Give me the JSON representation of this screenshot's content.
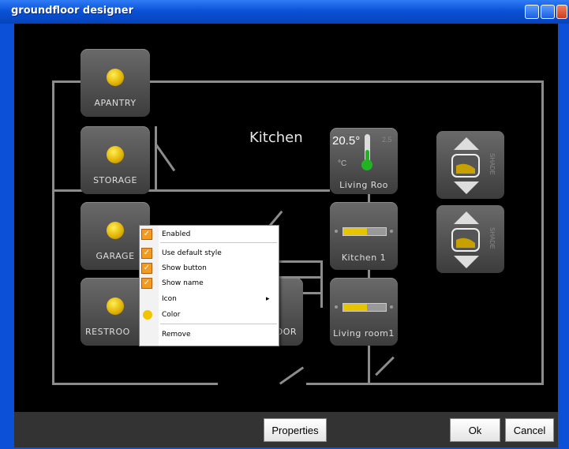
{
  "window": {
    "title": "groundfloor designer"
  },
  "rooms": {
    "kitchen": "Kitchen"
  },
  "tiles": {
    "apantry": "APANTRY",
    "storage": "STORAGE",
    "garage": "GARAGE",
    "restroom": "RESTROO",
    "door": "OOR",
    "living_room_thermo": "Living Roo",
    "kitchen1": "Kitchen 1",
    "living_room1": "Living room1"
  },
  "thermostat": {
    "temp": "20.5°",
    "unit": "°C",
    "side": "2.5"
  },
  "sliders": {
    "kitchen1_level": 0.55,
    "living_room1_level": 0.55
  },
  "blinds": {
    "label_1": "SHADE",
    "label_2": "SHADE"
  },
  "context_menu": {
    "items": [
      {
        "label": "Enabled",
        "checked": true
      },
      {
        "label": "Use default style",
        "checked": true
      },
      {
        "label": "Show button",
        "checked": true
      },
      {
        "label": "Show name",
        "checked": true
      },
      {
        "label": "Icon",
        "submenu": true
      },
      {
        "label": "Color"
      },
      {
        "label": "Remove"
      }
    ],
    "submenu_arrow": "▸"
  },
  "footer": {
    "properties_label": "Properties",
    "ok_label": "Ok",
    "cancel_label": "Cancel"
  },
  "colors": {
    "titlebar": "#0a52d8",
    "canvas": "#000000",
    "bulb": "#f2c400",
    "check": "#f39a20",
    "wall": "#8c8c8c"
  }
}
